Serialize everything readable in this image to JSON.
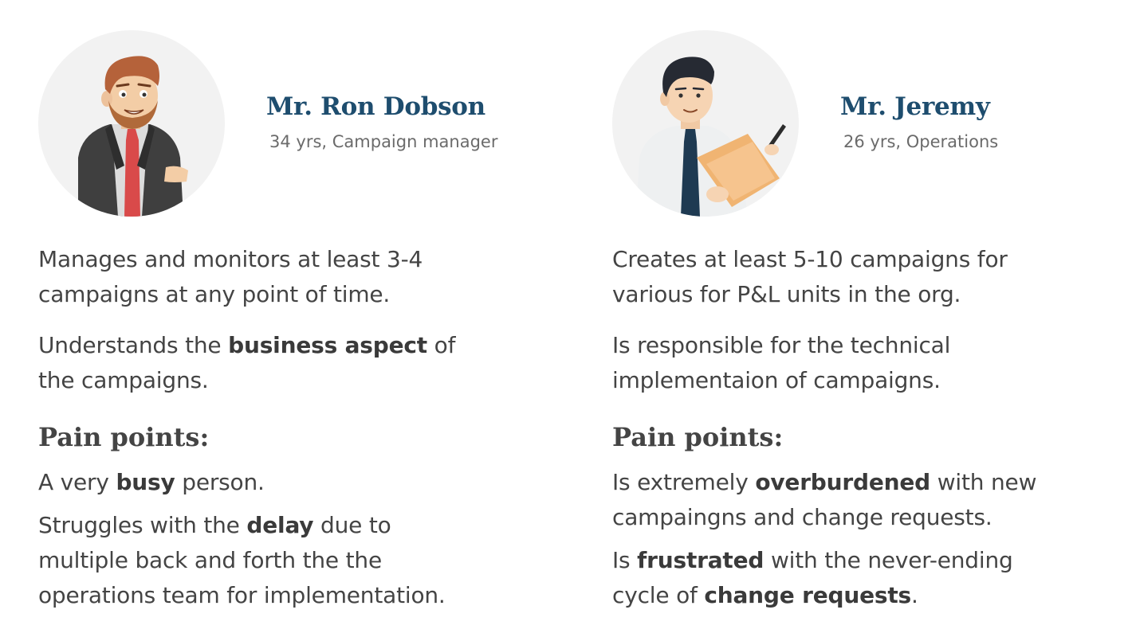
{
  "personas": [
    {
      "name": "Mr. Ron Dobson",
      "meta": "34 yrs, Campaign manager",
      "desc1": [
        "Manages and monitors at least 3-4",
        "campaigns at any point of time."
      ],
      "desc2_l1_a": "Understands the ",
      "desc2_l1_b": "business aspect",
      "desc2_l1_c": " of",
      "desc2_l2": "the campaigns.",
      "pain_title": "Pain points:",
      "pain1_a": "A very ",
      "pain1_b": "busy",
      "pain1_c": " person.",
      "pain2_l1_a": "Struggles with the ",
      "pain2_l1_b": "delay",
      "pain2_l1_c": " due to",
      "pain2_l2": "multiple back and forth the the",
      "pain2_l3": "operations team for implementation."
    },
    {
      "name": "Mr. Jeremy",
      "meta": "26 yrs, Operations",
      "desc1": [
        "Creates at least 5-10 campaigns for",
        "various for P&L units in the org."
      ],
      "desc2": [
        "Is responsible for the technical",
        "implementaion of campaigns."
      ],
      "pain_title": "Pain points:",
      "pain1_l1_a": "Is extremely ",
      "pain1_l1_b": "overburdened",
      "pain1_l1_c": " with new",
      "pain1_l2": "campaingns and change requests.",
      "pain2_l1_a": "Is ",
      "pain2_l1_b": "frustrated",
      "pain2_l1_c": " with the never-ending",
      "pain2_l2_a": "cycle of ",
      "pain2_l2_b": "change requests",
      "pain2_l2_c": "."
    }
  ],
  "colors": {
    "name": "#1e4d6e",
    "text": "#444444",
    "meta": "#6b6b6b",
    "avatar_bg": "#f2f2f2"
  }
}
